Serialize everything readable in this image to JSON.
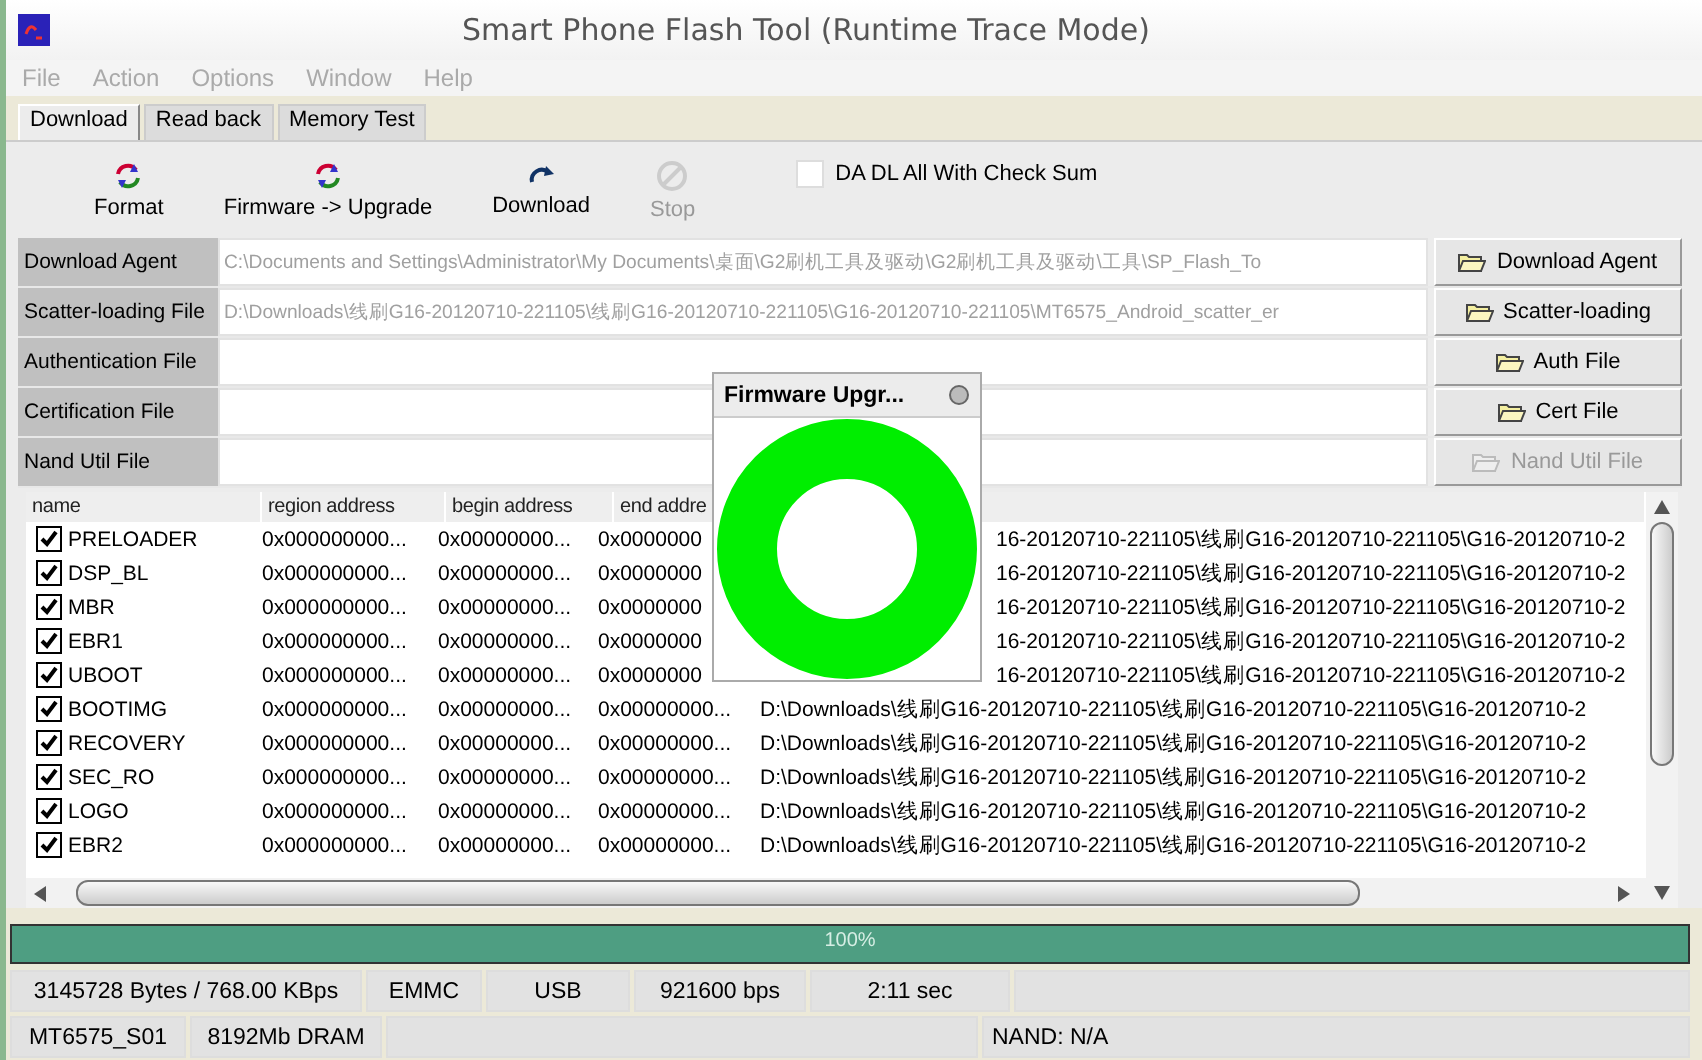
{
  "window": {
    "title": "Smart Phone Flash Tool (Runtime Trace Mode)"
  },
  "menu": [
    {
      "label": "File",
      "disabled": true
    },
    {
      "label": "Action",
      "disabled": true
    },
    {
      "label": "Options",
      "disabled": true
    },
    {
      "label": "Window",
      "disabled": true
    },
    {
      "label": "Help",
      "disabled": true
    }
  ],
  "tabs": [
    {
      "label": "Download",
      "selected": true
    },
    {
      "label": "Read back",
      "selected": false
    },
    {
      "label": "Memory Test",
      "selected": false
    }
  ],
  "toolbar": {
    "buttons": [
      {
        "label": "Format",
        "kind": "format",
        "disabled": false
      },
      {
        "label": "Firmware -> Upgrade",
        "kind": "format",
        "disabled": false
      },
      {
        "label": "Download",
        "kind": "download",
        "disabled": false
      },
      {
        "label": "Stop",
        "kind": "stop",
        "disabled": true
      }
    ],
    "checkbox": {
      "label": "DA DL All With Check Sum",
      "checked": false
    }
  },
  "files": [
    {
      "label": "Download Agent",
      "value": "C:\\Documents and Settings\\Administrator\\My Documents\\桌面\\G2刷机工具及驱动\\G2刷机工具及驱动\\工具\\SP_Flash_To",
      "button": "Download Agent",
      "disabled": false
    },
    {
      "label": "Scatter-loading File",
      "value": "D:\\Downloads\\线刷G16-20120710-221105\\线刷G16-20120710-221105\\G16-20120710-221105\\MT6575_Android_scatter_er",
      "button": "Scatter-loading",
      "disabled": false
    },
    {
      "label": "Authentication File",
      "button": "Auth File",
      "disabled": false
    },
    {
      "label": "Certification File",
      "button": "Cert File",
      "disabled": false
    },
    {
      "label": "Nand Util File",
      "button": "Nand Util File",
      "disabled": true
    }
  ],
  "table": {
    "columns": [
      "name",
      "region address",
      "begin address",
      "end addre"
    ],
    "rows": [
      {
        "kind": "under_popup",
        "checked": true,
        "name": "PRELOADER",
        "region": "0x000000000...",
        "begin": "0x00000000...",
        "end": "0x0000000",
        "location": "16-20120710-221105\\线刷G16-20120710-221105\\G16-20120710-2"
      },
      {
        "kind": "under_popup",
        "checked": true,
        "name": "DSP_BL",
        "region": "0x000000000...",
        "begin": "0x00000000...",
        "end": "0x0000000",
        "location": "16-20120710-221105\\线刷G16-20120710-221105\\G16-20120710-2"
      },
      {
        "kind": "under_popup",
        "checked": true,
        "name": "MBR",
        "region": "0x000000000...",
        "begin": "0x00000000...",
        "end": "0x0000000",
        "location": "16-20120710-221105\\线刷G16-20120710-221105\\G16-20120710-2"
      },
      {
        "kind": "under_popup",
        "checked": true,
        "name": "EBR1",
        "region": "0x000000000...",
        "begin": "0x00000000...",
        "end": "0x0000000",
        "location": "16-20120710-221105\\线刷G16-20120710-221105\\G16-20120710-2"
      },
      {
        "kind": "under_popup",
        "checked": true,
        "name": "UBOOT",
        "region": "0x000000000...",
        "begin": "0x00000000...",
        "end": "0x0000000",
        "location": "16-20120710-221105\\线刷G16-20120710-221105\\G16-20120710-2"
      },
      {
        "kind": "full",
        "checked": true,
        "name": "BOOTIMG",
        "region": "0x000000000...",
        "begin": "0x00000000...",
        "end": "0x00000000...",
        "location": "D:\\Downloads\\线刷G16-20120710-221105\\线刷G16-20120710-221105\\G16-20120710-2"
      },
      {
        "kind": "full",
        "checked": true,
        "name": "RECOVERY",
        "region": "0x000000000...",
        "begin": "0x00000000...",
        "end": "0x00000000...",
        "location": "D:\\Downloads\\线刷G16-20120710-221105\\线刷G16-20120710-221105\\G16-20120710-2"
      },
      {
        "kind": "full",
        "checked": true,
        "name": "SEC_RO",
        "region": "0x000000000...",
        "begin": "0x00000000...",
        "end": "0x00000000...",
        "location": "D:\\Downloads\\线刷G16-20120710-221105\\线刷G16-20120710-221105\\G16-20120710-2"
      },
      {
        "kind": "full",
        "checked": true,
        "name": "LOGO",
        "region": "0x000000000...",
        "begin": "0x00000000...",
        "end": "0x00000000...",
        "location": "D:\\Downloads\\线刷G16-20120710-221105\\线刷G16-20120710-221105\\G16-20120710-2"
      },
      {
        "kind": "full",
        "checked": true,
        "name": "EBR2",
        "region": "0x000000000...",
        "begin": "0x00000000...",
        "end": "0x00000000...",
        "location": "D:\\Downloads\\线刷G16-20120710-221105\\线刷G16-20120710-221105\\G16-20120710-2"
      }
    ]
  },
  "popup": {
    "title": "Firmware Upgr..."
  },
  "progress": {
    "level": 1.0,
    "text": "100%"
  },
  "status_bar": {
    "row_1": [
      "3145728 Bytes / 768.00 KBps",
      "EMMC",
      "USB",
      "921600 bps",
      "2:11 sec"
    ],
    "row_2": [
      "MT6575_S01",
      "8192Mb DRAM",
      "NAND: N/A"
    ]
  }
}
